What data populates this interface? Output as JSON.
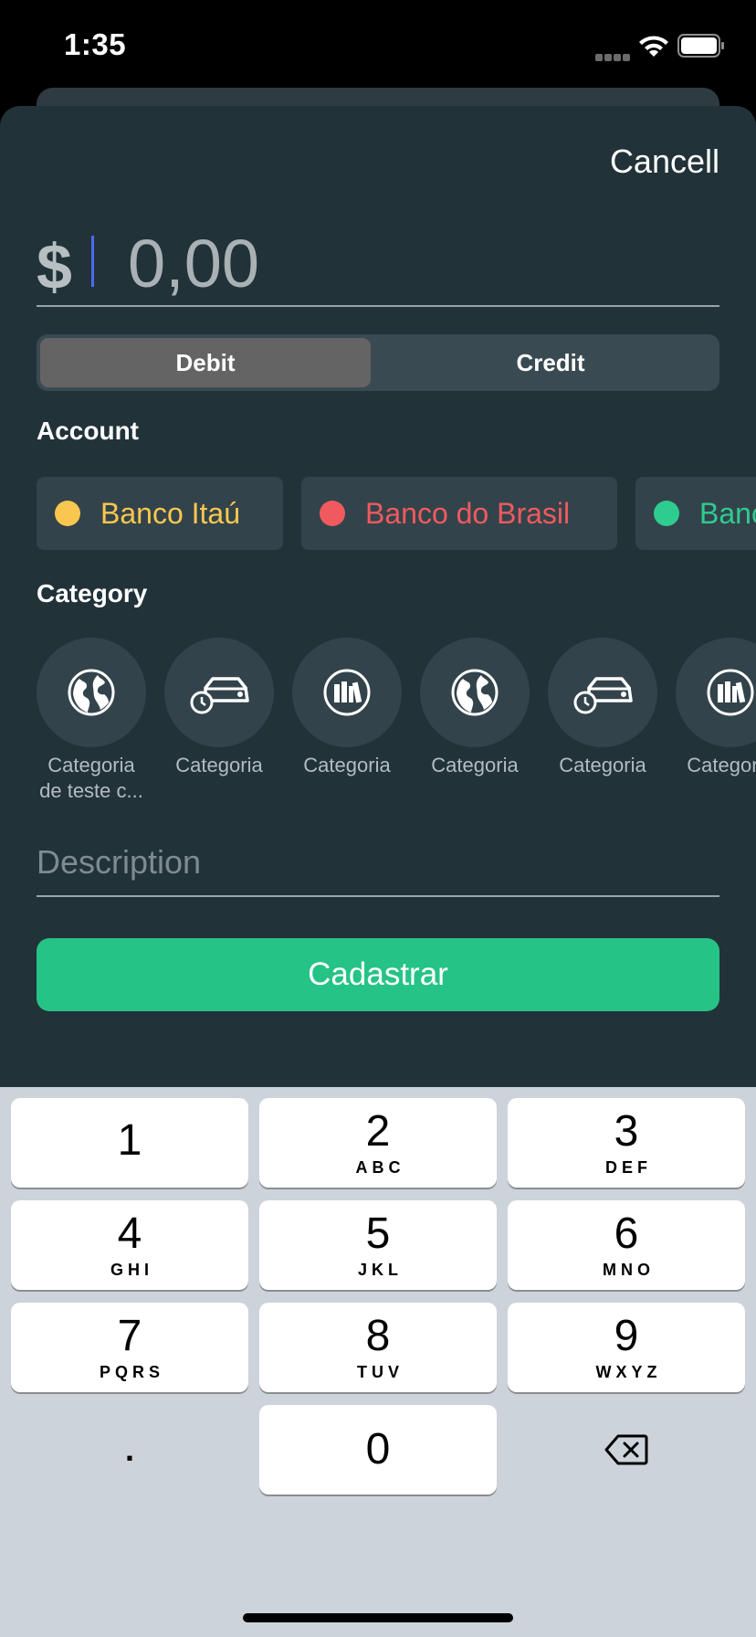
{
  "status_bar": {
    "time": "1:35"
  },
  "header": {
    "cancel_label": "Cancell"
  },
  "amount": {
    "currency_symbol": "$",
    "placeholder": "0,00"
  },
  "type_toggle": {
    "options": [
      "Debit",
      "Credit"
    ],
    "selected": "Debit"
  },
  "accounts": {
    "label": "Account",
    "items": [
      {
        "name": "Banco Itaú",
        "color": "#f9c74f"
      },
      {
        "name": "Banco do Brasil",
        "color": "#f05a5e"
      },
      {
        "name": "Banco",
        "color": "#2ecc8f"
      }
    ]
  },
  "categories": {
    "label": "Category",
    "items": [
      {
        "label": "Categoria de teste c...",
        "icon": "globe-icon"
      },
      {
        "label": "Categoria",
        "icon": "car-clock-icon"
      },
      {
        "label": "Categoria",
        "icon": "books-icon"
      },
      {
        "label": "Categoria",
        "icon": "globe-icon"
      },
      {
        "label": "Categoria",
        "icon": "car-clock-icon"
      },
      {
        "label": "Categoria",
        "icon": "books-icon"
      }
    ]
  },
  "description": {
    "placeholder": "Description"
  },
  "submit": {
    "label": "Cadastrar"
  },
  "keyboard": {
    "keys": [
      {
        "digit": "1",
        "letters": ""
      },
      {
        "digit": "2",
        "letters": "ABC"
      },
      {
        "digit": "3",
        "letters": "DEF"
      },
      {
        "digit": "4",
        "letters": "GHI"
      },
      {
        "digit": "5",
        "letters": "JKL"
      },
      {
        "digit": "6",
        "letters": "MNO"
      },
      {
        "digit": "7",
        "letters": "PQRS"
      },
      {
        "digit": "8",
        "letters": "TUV"
      },
      {
        "digit": "9",
        "letters": "WXYZ"
      },
      {
        "digit": "0",
        "letters": ""
      }
    ],
    "decimal_key": ".",
    "delete_icon": "backspace-icon"
  },
  "colors": {
    "accent": "#25c386",
    "sheet_background": "#223239",
    "card_background": "#33434b",
    "caret": "#4b6cf0"
  }
}
